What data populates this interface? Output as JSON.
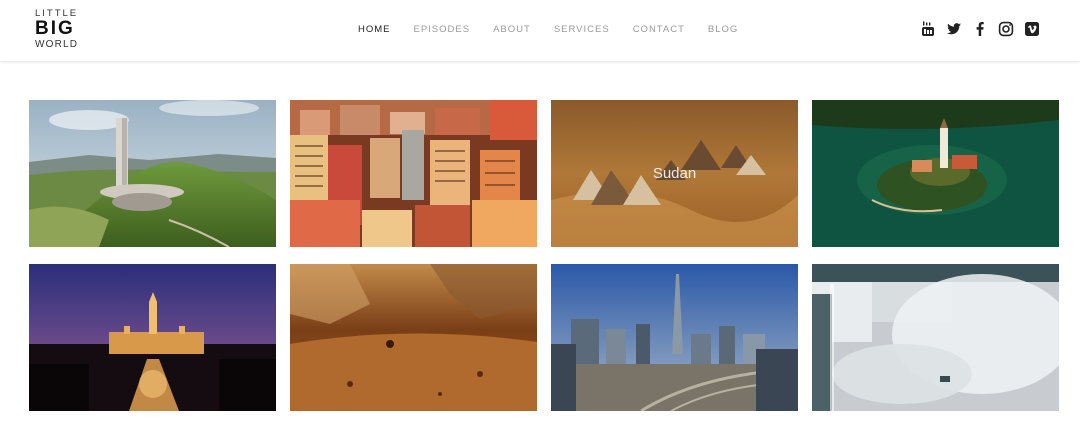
{
  "logo": {
    "line1": "LITTLE",
    "line2": "BIG",
    "line3": "WORLD"
  },
  "nav": {
    "items": [
      {
        "label": "HOME",
        "active": true
      },
      {
        "label": "EPISODES",
        "active": false
      },
      {
        "label": "ABOUT",
        "active": false
      },
      {
        "label": "SERVICES",
        "active": false
      },
      {
        "label": "CONTACT",
        "active": false
      },
      {
        "label": "BLOG",
        "active": false
      }
    ]
  },
  "social": {
    "icons": [
      "youtube-icon",
      "twitter-icon",
      "facebook-icon",
      "instagram-icon",
      "vimeo-icon"
    ]
  },
  "gallery": {
    "tiles": [
      {
        "caption": ""
      },
      {
        "caption": ""
      },
      {
        "caption": "Sudan"
      },
      {
        "caption": ""
      },
      {
        "caption": ""
      },
      {
        "caption": ""
      },
      {
        "caption": ""
      },
      {
        "caption": ""
      }
    ]
  },
  "colors": {
    "nav_active": "#222222",
    "nav_inactive": "#9a9a9a",
    "header_bg": "#ffffff",
    "icon": "#222222"
  }
}
